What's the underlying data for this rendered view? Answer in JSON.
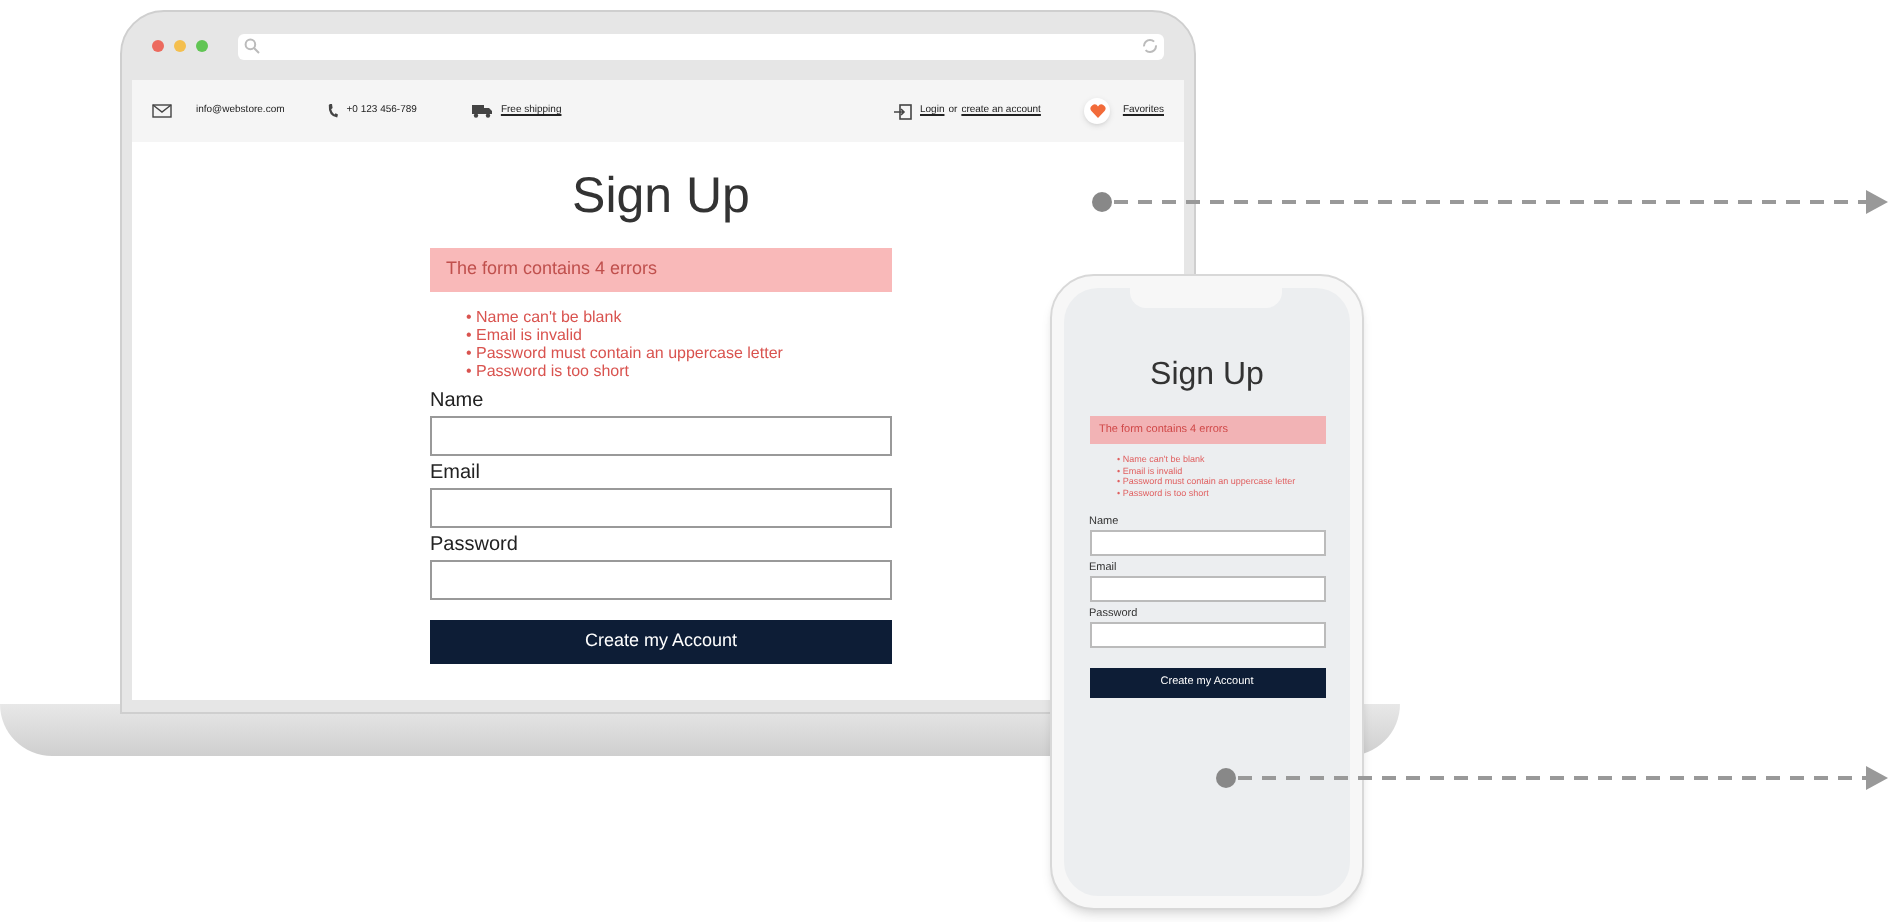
{
  "laptop": {
    "browser": {
      "traffic_lights": [
        {
          "color": "#ec6a5e"
        },
        {
          "color": "#f4bf4f"
        },
        {
          "color": "#61c554"
        }
      ]
    },
    "header": {
      "email": "info@webstore.com",
      "phone": "+0 123 456-789",
      "shipping": "Free shipping",
      "login": "Login",
      "or": "or",
      "create_account": "create an account",
      "favorites": "Favorites"
    },
    "form": {
      "title": "Sign Up",
      "error_summary": "The form contains 4 errors",
      "errors": [
        "• Name can't be blank",
        "• Email is invalid",
        "• Password must contain an uppercase letter",
        "• Password is too short"
      ],
      "fields": [
        {
          "label": "Name"
        },
        {
          "label": "Email"
        },
        {
          "label": "Password"
        }
      ],
      "button": "Create my Account"
    }
  },
  "phone": {
    "form": {
      "title": "Sign Up",
      "error_summary": "The form contains 4 errors",
      "errors": [
        "• Name can't be blank",
        "• Email is invalid",
        "• Password must contain an uppercase letter",
        "• Password is too short"
      ],
      "fields": [
        {
          "label": "Name"
        },
        {
          "label": "Email"
        },
        {
          "label": "Password"
        }
      ],
      "button": "Create my Account"
    }
  }
}
